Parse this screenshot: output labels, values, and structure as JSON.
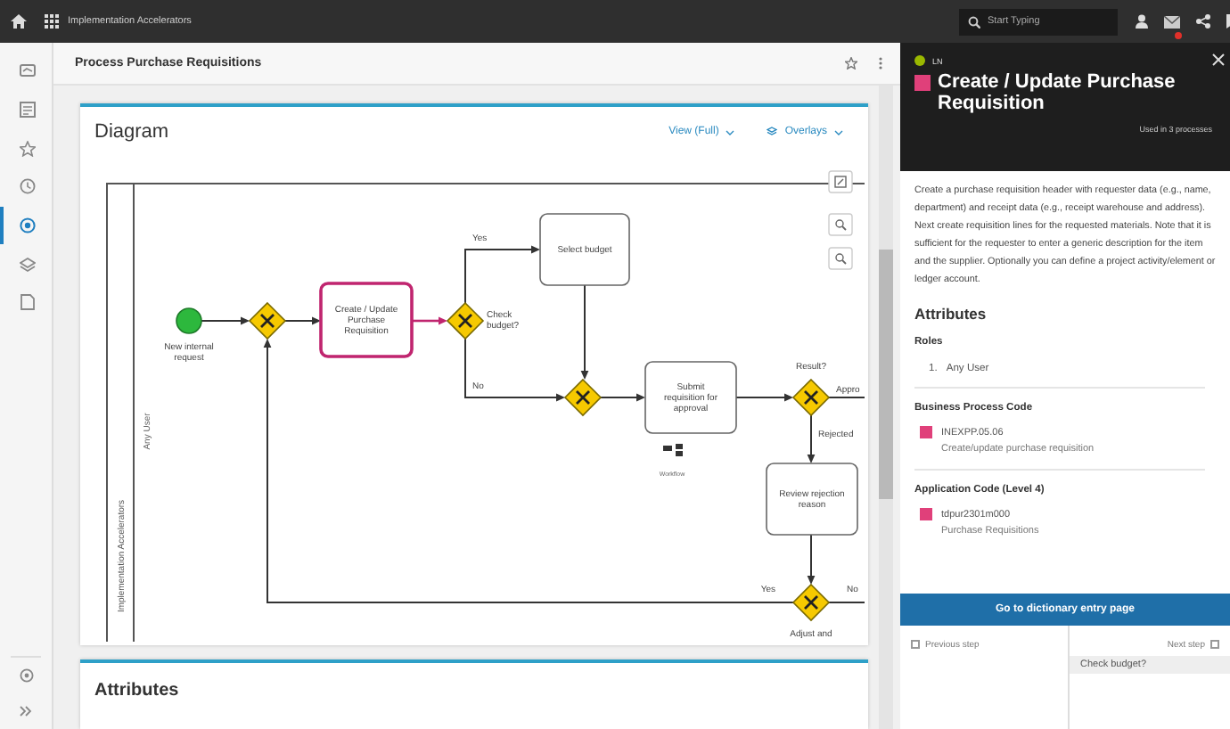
{
  "top_bar": {
    "app_title": "Implementation Accelerators",
    "search": {
      "placeholder": "Start Typing"
    },
    "has_notification": true
  },
  "sidebar": {
    "items": [
      {
        "selected": false
      },
      {
        "selected": false
      },
      {
        "selected": false
      },
      {
        "selected": false
      },
      {
        "selected": true
      },
      {
        "selected": false
      },
      {
        "selected": false
      }
    ]
  },
  "page": {
    "title": "Process Purchase Requisitions"
  },
  "diagram_card": {
    "title": "Diagram",
    "view_menu": "View (Full)",
    "overlays_menu": "Overlays",
    "pool": "Implementation Accelerators",
    "lane": "Any User",
    "nodes": [
      {
        "kind": "start",
        "lines": [
          "New internal",
          "request"
        ],
        "selected": false
      },
      {
        "kind": "gateway",
        "selected": false
      },
      {
        "kind": "task",
        "lines": [
          "Create / Update",
          "Purchase",
          "Requisition"
        ],
        "selected": true
      },
      {
        "kind": "gateway",
        "lines": [
          "Check",
          "budget?"
        ],
        "selected": false
      },
      {
        "kind": "task",
        "lines": [
          "Select budget"
        ],
        "selected": false
      },
      {
        "kind": "gateway",
        "selected": false
      },
      {
        "kind": "task",
        "lines": [
          "Submit",
          "requisition for",
          "approval"
        ],
        "marker": "Workflow",
        "selected": false
      },
      {
        "kind": "gateway",
        "lines": [
          "Result?"
        ],
        "selected": false
      },
      {
        "kind": "task",
        "lines": [
          "Review rejection",
          "reason"
        ],
        "selected": false
      },
      {
        "kind": "gateway",
        "lines": [
          "Adjust and"
        ],
        "selected": false
      }
    ],
    "edge_labels": [
      "Yes",
      "No",
      "Appro",
      "Rejected",
      "Yes",
      "No"
    ]
  },
  "attributes_card": {
    "title": "Attributes"
  },
  "detail_panel": {
    "source": "LN",
    "title": "Create / Update Purchase Requisition",
    "usage": "Used in 3 processes",
    "description": "Create a purchase requisition header with requester data (e.g., name, department) and receipt data (e.g., receipt warehouse and address). Next create requisition lines for the requested materials. Note that it is sufficient for the requester to enter a generic description for the item and the supplier. Optionally you can define a project activity/element or ledger account.",
    "attributes_title": "Attributes",
    "roles_title": "Roles",
    "roles": [
      {
        "number": "1.",
        "name": "Any User"
      }
    ],
    "codes": [
      {
        "title": "Business Process Code",
        "code": "INEXPP.05.06",
        "description": "Create/update purchase requisition"
      },
      {
        "title": "Application Code (Level 4)",
        "code": "tdpur2301m000",
        "description": "Purchase Requisitions"
      }
    ],
    "action": "Go to dictionary entry page",
    "previous_step": "Previous step",
    "next_step": "Next step",
    "next_items": [
      "Check budget?"
    ]
  }
}
